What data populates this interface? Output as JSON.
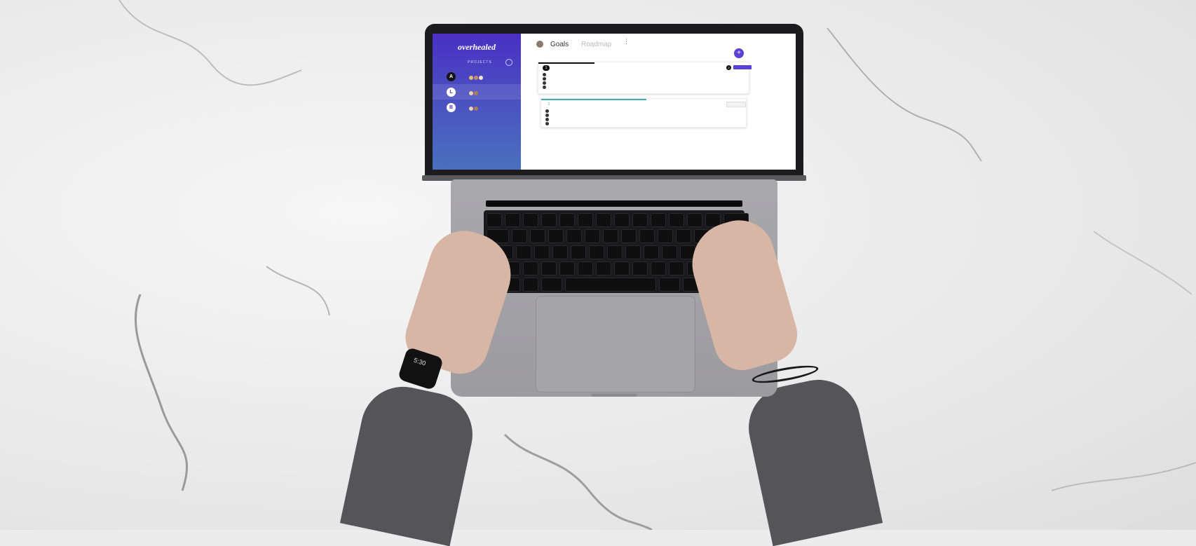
{
  "app": {
    "brand": "overhealed",
    "sidebar": {
      "section_label": "PROJECTS",
      "projects": [
        {
          "badge": "A",
          "name": "",
          "dark": true
        },
        {
          "badge": "L",
          "name": "",
          "dark": false
        },
        {
          "badge": "B",
          "name": "",
          "dark": false
        }
      ]
    },
    "tabs": [
      {
        "label": "Goals"
      },
      {
        "label": "Roadmap"
      }
    ],
    "add_button": "+",
    "cards": [
      {
        "number": "1",
        "count": "2",
        "progress_color": "#111111"
      },
      {
        "number": "1",
        "progress_color": "#3fa9b5"
      }
    ]
  },
  "watch": {
    "time": "5:30"
  },
  "colors": {
    "sidebar_top": "#4a30c4",
    "sidebar_bottom": "#4a70be",
    "accent": "#5b3fd6",
    "laptop_body": "#a9a8ad",
    "keyboard": "#1a1a1c",
    "sleeve": "#555559"
  }
}
